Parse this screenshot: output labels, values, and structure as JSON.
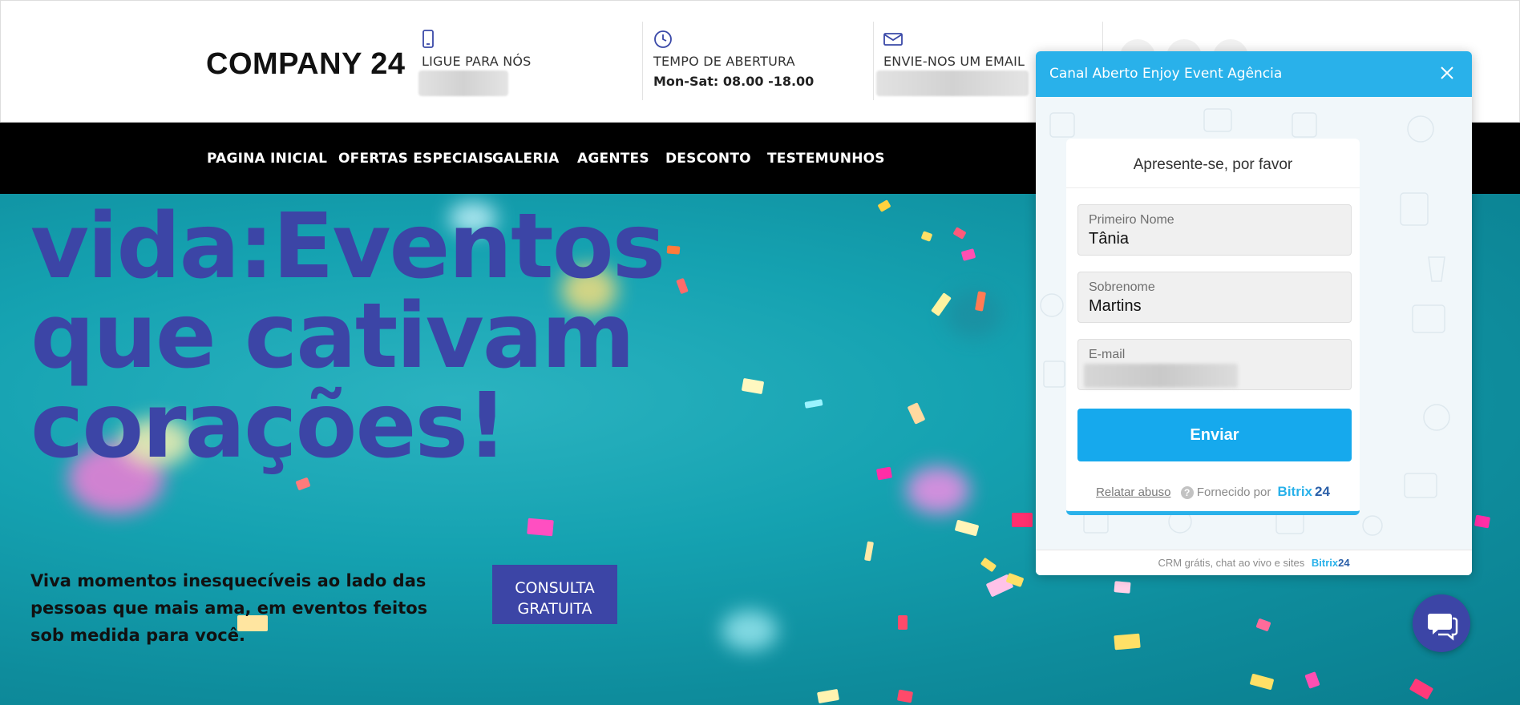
{
  "header": {
    "logo": "COMPANY 24",
    "phone": {
      "icon": "phone-icon",
      "label": "LIGUE PARA NÓS"
    },
    "hours": {
      "icon": "clock-icon",
      "label": "TEMPO DE ABERTURA",
      "value": "Mon-Sat: 08.00 -18.00"
    },
    "email": {
      "icon": "mail-icon",
      "label": "ENVIE-NOS UM EMAIL"
    }
  },
  "nav": {
    "items": [
      "PAGINA INICIAL",
      "OFERTAS ESPECIAIS",
      "GALERIA",
      "AGENTES",
      "DESCONTO",
      "TESTEMUNHOS"
    ]
  },
  "hero": {
    "title_line1": "vida:Eventos",
    "title_line2": "que cativam",
    "title_line3": "corações!",
    "subtitle": "Viva momentos inesquecíveis ao lado das pessoas que mais ama, em eventos feitos sob medida para você.",
    "cta_line1": "CONSULTA",
    "cta_line2": "GRATUITA"
  },
  "chat": {
    "title": "Canal Aberto Enjoy Event Agência",
    "close_icon": "close-icon",
    "form_heading": "Apresente-se, por favor",
    "fields": [
      {
        "label": "Primeiro Nome",
        "value": "Tânia"
      },
      {
        "label": "Sobrenome",
        "value": "Martins"
      },
      {
        "label": "E-mail",
        "value": ""
      }
    ],
    "submit": "Enviar",
    "report_abuse": "Relatar abuso",
    "powered_by": "Fornecido por",
    "brand_part1": "Bitrix",
    "brand_part2": "24",
    "bottom_text": "CRM grátis, chat ao vivo e sites",
    "bottom_brand1": "Bitrix",
    "bottom_brand2": "24"
  },
  "colors": {
    "accent": "#3c45a6",
    "chat_blue": "#29b1ea",
    "hero_teal": "#15a2b1"
  }
}
